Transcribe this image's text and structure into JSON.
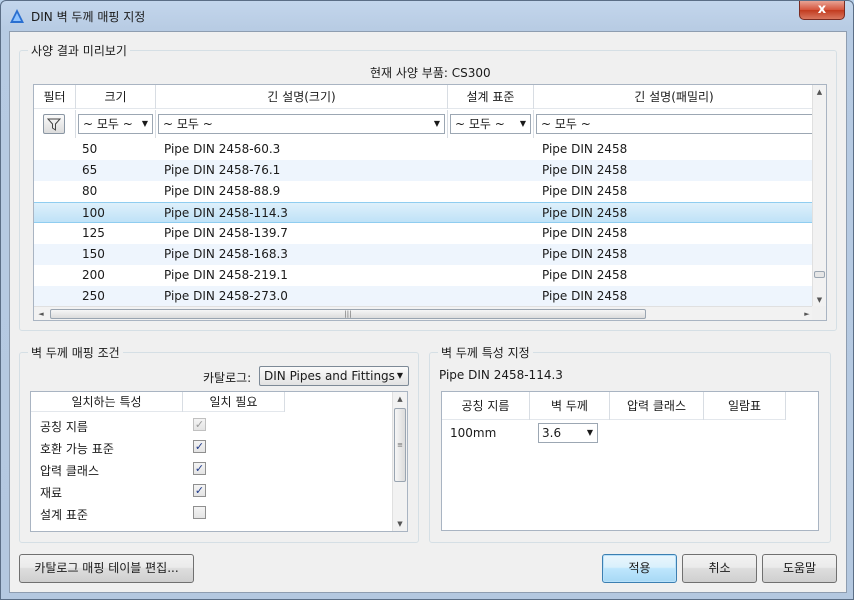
{
  "window": {
    "title": "DIN 벽 두께 매핑 지정",
    "close_label": "x"
  },
  "preview": {
    "legend": "사양 결과 미리보기",
    "current_part": "현재 사양 부품: CS300",
    "columns": [
      "필터",
      "크기",
      "긴 설명(크기)",
      "설계 표준",
      "긴 설명(패밀리)"
    ],
    "filters": {
      "size": "~ 모두 ~",
      "desc_size": "~ 모두 ~",
      "standard": "~ 모두 ~",
      "desc_family": "~ 모두 ~"
    },
    "rows": [
      {
        "size": "50",
        "desc": "Pipe DIN 2458-60.3",
        "family": "Pipe DIN 2458"
      },
      {
        "size": "65",
        "desc": "Pipe DIN 2458-76.1",
        "family": "Pipe DIN 2458"
      },
      {
        "size": "80",
        "desc": "Pipe DIN 2458-88.9",
        "family": "Pipe DIN 2458"
      },
      {
        "size": "100",
        "desc": "Pipe DIN 2458-114.3",
        "family": "Pipe DIN 2458"
      },
      {
        "size": "125",
        "desc": "Pipe DIN 2458-139.7",
        "family": "Pipe DIN 2458"
      },
      {
        "size": "150",
        "desc": "Pipe DIN 2458-168.3",
        "family": "Pipe DIN 2458"
      },
      {
        "size": "200",
        "desc": "Pipe DIN 2458-219.1",
        "family": "Pipe DIN 2458"
      },
      {
        "size": "250",
        "desc": "Pipe DIN 2458-273.0",
        "family": "Pipe DIN 2458"
      }
    ],
    "selected_row_index": 3
  },
  "mapping": {
    "legend": "벽 두께 매핑 조건",
    "catalog_label": "카탈로그:",
    "catalog_value": "DIN Pipes and Fittings",
    "columns": [
      "일치하는 특성",
      "일치 필요"
    ],
    "properties": [
      {
        "name": "공칭 지름",
        "checked": true,
        "disabled": true
      },
      {
        "name": "호환 가능 표준",
        "checked": true,
        "disabled": false
      },
      {
        "name": "압력 클래스",
        "checked": true,
        "disabled": false
      },
      {
        "name": "재료",
        "checked": true,
        "disabled": false
      },
      {
        "name": "설계 표준",
        "checked": false,
        "disabled": false
      }
    ]
  },
  "wall": {
    "legend": "벽 두께 특성 지정",
    "part_name": "Pipe DIN 2458-114.3",
    "columns": [
      "공칭 지름",
      "벽 두께",
      "압력 클래스",
      "일람표"
    ],
    "row": {
      "size": "100mm",
      "thickness": "3.6"
    }
  },
  "buttons": {
    "edit_catalog": "카탈로그 매핑 테이블 편집...",
    "apply": "적용",
    "cancel": "취소",
    "help": "도움말"
  }
}
